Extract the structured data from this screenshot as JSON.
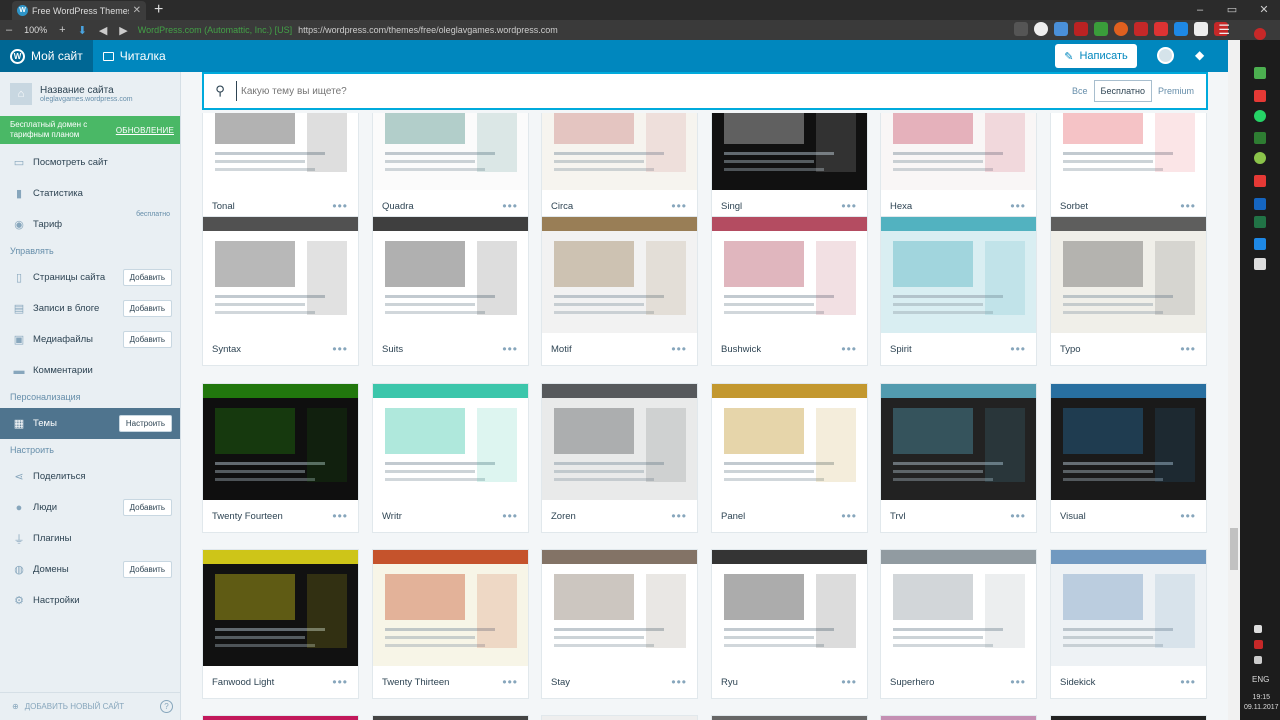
{
  "browser": {
    "tab_title": "Free WordPress Themes — Hi",
    "zoom": "100%",
    "secure_label": "WordPress.com (Automattic, Inc.) [US]",
    "url": "https://wordpress.com/themes/free/oleglavgames.wordpress.com"
  },
  "masterbar": {
    "my_site": "Мой сайт",
    "reader": "Читалка",
    "write": "Написать"
  },
  "sidebar": {
    "site_name": "Название сайта",
    "site_url": "oleglavgames.wordpress.com",
    "plan_text": "Бесплатный домен с тарифным планом",
    "plan_upgrade": "ОБНОВЛЕНИЕ",
    "top_items": [
      {
        "label": "Посмотреть сайт",
        "icon": "monitor-icon"
      },
      {
        "label": "Статистика",
        "icon": "stats-icon"
      },
      {
        "label": "Тариф",
        "icon": "plan-icon",
        "tag": "бесплатно"
      }
    ],
    "manage_header": "Управлять",
    "manage_items": [
      {
        "label": "Страницы сайта",
        "icon": "pages-icon",
        "button": "Добавить"
      },
      {
        "label": "Записи в блоге",
        "icon": "posts-icon",
        "button": "Добавить"
      },
      {
        "label": "Медиафайлы",
        "icon": "media-icon",
        "button": "Добавить"
      },
      {
        "label": "Комментарии",
        "icon": "comments-icon"
      }
    ],
    "personalize_header": "Персонализация",
    "themes_label": "Темы",
    "themes_button": "Настроить",
    "configure_header": "Настроить",
    "configure_items": [
      {
        "label": "Поделиться",
        "icon": "share-icon"
      },
      {
        "label": "Люди",
        "icon": "people-icon",
        "button": "Добавить"
      },
      {
        "label": "Плагины",
        "icon": "plugins-icon"
      },
      {
        "label": "Домены",
        "icon": "domains-icon",
        "button": "Добавить"
      },
      {
        "label": "Настройки",
        "icon": "settings-icon"
      }
    ],
    "add_site": "ДОБАВИТЬ НОВЫЙ САЙТ"
  },
  "search": {
    "placeholder": "Какую тему вы ищете?",
    "filter_all": "Все",
    "filter_free": "Бесплатно",
    "filter_premium": "Premium"
  },
  "themes": [
    {
      "name": "Tonal",
      "bg": "#ffffff",
      "accent": "#222222"
    },
    {
      "name": "Quadra",
      "bg": "#fbfbfb",
      "accent": "#2a7a6f"
    },
    {
      "name": "Circa",
      "bg": "#f6f4ef",
      "accent": "#c36e6e"
    },
    {
      "name": "Singl",
      "bg": "#111111",
      "accent": "#f4f4f4"
    },
    {
      "name": "Hexa",
      "bg": "#f9f6f6",
      "accent": "#c0324c"
    },
    {
      "name": "Sorbet",
      "bg": "#ffffff",
      "accent": "#e3525d"
    },
    {
      "name": "Syntax",
      "bg": "#ffffff",
      "accent": "#333333"
    },
    {
      "name": "Suits",
      "bg": "#ffffff",
      "accent": "#1d1d1d"
    },
    {
      "name": "Motif",
      "bg": "#f2f2f2",
      "accent": "#8a6a3b"
    },
    {
      "name": "Bushwick",
      "bg": "#ffffff",
      "accent": "#a72d45"
    },
    {
      "name": "Spirit",
      "bg": "#d9eef2",
      "accent": "#3aa7b7"
    },
    {
      "name": "Typo",
      "bg": "#f0efe9",
      "accent": "#444444"
    },
    {
      "name": "Twenty Fourteen",
      "bg": "#0f0f0f",
      "accent": "#24890d"
    },
    {
      "name": "Writr",
      "bg": "#ffffff",
      "accent": "#1abc9c"
    },
    {
      "name": "Zoren",
      "bg": "#e9eaea",
      "accent": "#3c4043"
    },
    {
      "name": "Panel",
      "bg": "#ffffff",
      "accent": "#b8860b"
    },
    {
      "name": "Trvl",
      "bg": "#222222",
      "accent": "#5ab0c8"
    },
    {
      "name": "Visual",
      "bg": "#1a1a1a",
      "accent": "#2c7fb8"
    },
    {
      "name": "Fanwood Light",
      "bg": "#111111",
      "accent": "#f0e51a"
    },
    {
      "name": "Twenty Thirteen",
      "bg": "#f7f5e7",
      "accent": "#bc360a"
    },
    {
      "name": "Stay",
      "bg": "#ffffff",
      "accent": "#6d5b4b"
    },
    {
      "name": "Ryu",
      "bg": "#ffffff",
      "accent": "#111111"
    },
    {
      "name": "Superhero",
      "bg": "#ffffff",
      "accent": "#7e8a91"
    },
    {
      "name": "Sidekick",
      "bg": "#eef2f5",
      "accent": "#5b8ab6"
    }
  ],
  "taskbar": {
    "lang": "ENG",
    "time": "19:15",
    "date": "09.11.2017"
  },
  "colors": {
    "masterbar": "#0087be",
    "sidebar": "#e9eff3",
    "selected": "#4f748e",
    "banner": "#4ab866",
    "search_border": "#00aadc"
  }
}
